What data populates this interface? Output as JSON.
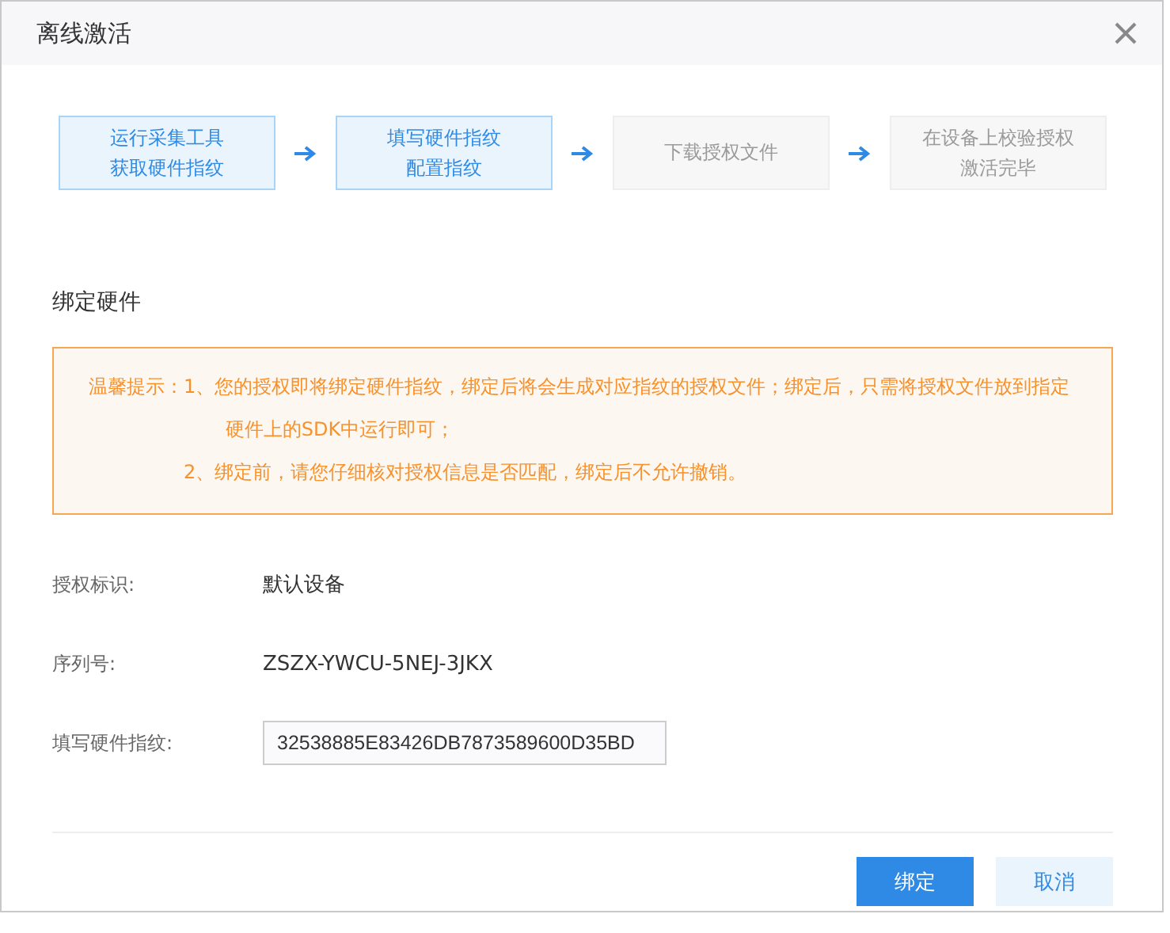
{
  "window": {
    "title": "离线激活"
  },
  "steps": [
    {
      "lines": [
        "运行采集工具",
        "获取硬件指纹"
      ],
      "active": true
    },
    {
      "lines": [
        "填写硬件指纹",
        "配置指纹"
      ],
      "active": true
    },
    {
      "lines": [
        "下载授权文件"
      ],
      "active": false
    },
    {
      "lines": [
        "在设备上校验授权",
        "激活完毕"
      ],
      "active": false
    }
  ],
  "section_title": "绑定硬件",
  "notice": {
    "label": "温馨提示：",
    "items": [
      "1、您的授权即将绑定硬件指纹，绑定后将会生成对应指纹的授权文件；绑定后，只需将授权文件放到指定硬件上的SDK中运行即可；",
      "2、绑定前，请您仔细核对授权信息是否匹配，绑定后不允许撤销。"
    ]
  },
  "fields": [
    {
      "label": "授权标识:",
      "kind": "text",
      "value": "默认设备"
    },
    {
      "label": "序列号:",
      "kind": "text",
      "value": "ZSZX-YWCU-5NEJ-3JKX"
    },
    {
      "label": "填写硬件指纹:",
      "kind": "input",
      "value": "32538885E83426DB7873589600D35BD"
    }
  ],
  "buttons": [
    {
      "label": "绑定",
      "kind": "primary"
    },
    {
      "label": "取消",
      "kind": "secondary"
    }
  ]
}
